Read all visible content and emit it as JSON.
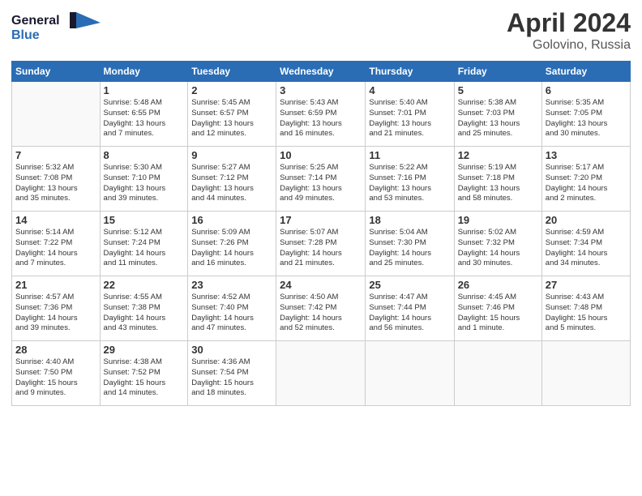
{
  "header": {
    "logo_line1": "General",
    "logo_line2": "Blue",
    "month": "April 2024",
    "location": "Golovino, Russia"
  },
  "weekdays": [
    "Sunday",
    "Monday",
    "Tuesday",
    "Wednesday",
    "Thursday",
    "Friday",
    "Saturday"
  ],
  "weeks": [
    [
      {
        "day": "",
        "info": ""
      },
      {
        "day": "1",
        "info": "Sunrise: 5:48 AM\nSunset: 6:55 PM\nDaylight: 13 hours\nand 7 minutes."
      },
      {
        "day": "2",
        "info": "Sunrise: 5:45 AM\nSunset: 6:57 PM\nDaylight: 13 hours\nand 12 minutes."
      },
      {
        "day": "3",
        "info": "Sunrise: 5:43 AM\nSunset: 6:59 PM\nDaylight: 13 hours\nand 16 minutes."
      },
      {
        "day": "4",
        "info": "Sunrise: 5:40 AM\nSunset: 7:01 PM\nDaylight: 13 hours\nand 21 minutes."
      },
      {
        "day": "5",
        "info": "Sunrise: 5:38 AM\nSunset: 7:03 PM\nDaylight: 13 hours\nand 25 minutes."
      },
      {
        "day": "6",
        "info": "Sunrise: 5:35 AM\nSunset: 7:05 PM\nDaylight: 13 hours\nand 30 minutes."
      }
    ],
    [
      {
        "day": "7",
        "info": "Sunrise: 5:32 AM\nSunset: 7:08 PM\nDaylight: 13 hours\nand 35 minutes."
      },
      {
        "day": "8",
        "info": "Sunrise: 5:30 AM\nSunset: 7:10 PM\nDaylight: 13 hours\nand 39 minutes."
      },
      {
        "day": "9",
        "info": "Sunrise: 5:27 AM\nSunset: 7:12 PM\nDaylight: 13 hours\nand 44 minutes."
      },
      {
        "day": "10",
        "info": "Sunrise: 5:25 AM\nSunset: 7:14 PM\nDaylight: 13 hours\nand 49 minutes."
      },
      {
        "day": "11",
        "info": "Sunrise: 5:22 AM\nSunset: 7:16 PM\nDaylight: 13 hours\nand 53 minutes."
      },
      {
        "day": "12",
        "info": "Sunrise: 5:19 AM\nSunset: 7:18 PM\nDaylight: 13 hours\nand 58 minutes."
      },
      {
        "day": "13",
        "info": "Sunrise: 5:17 AM\nSunset: 7:20 PM\nDaylight: 14 hours\nand 2 minutes."
      }
    ],
    [
      {
        "day": "14",
        "info": "Sunrise: 5:14 AM\nSunset: 7:22 PM\nDaylight: 14 hours\nand 7 minutes."
      },
      {
        "day": "15",
        "info": "Sunrise: 5:12 AM\nSunset: 7:24 PM\nDaylight: 14 hours\nand 11 minutes."
      },
      {
        "day": "16",
        "info": "Sunrise: 5:09 AM\nSunset: 7:26 PM\nDaylight: 14 hours\nand 16 minutes."
      },
      {
        "day": "17",
        "info": "Sunrise: 5:07 AM\nSunset: 7:28 PM\nDaylight: 14 hours\nand 21 minutes."
      },
      {
        "day": "18",
        "info": "Sunrise: 5:04 AM\nSunset: 7:30 PM\nDaylight: 14 hours\nand 25 minutes."
      },
      {
        "day": "19",
        "info": "Sunrise: 5:02 AM\nSunset: 7:32 PM\nDaylight: 14 hours\nand 30 minutes."
      },
      {
        "day": "20",
        "info": "Sunrise: 4:59 AM\nSunset: 7:34 PM\nDaylight: 14 hours\nand 34 minutes."
      }
    ],
    [
      {
        "day": "21",
        "info": "Sunrise: 4:57 AM\nSunset: 7:36 PM\nDaylight: 14 hours\nand 39 minutes."
      },
      {
        "day": "22",
        "info": "Sunrise: 4:55 AM\nSunset: 7:38 PM\nDaylight: 14 hours\nand 43 minutes."
      },
      {
        "day": "23",
        "info": "Sunrise: 4:52 AM\nSunset: 7:40 PM\nDaylight: 14 hours\nand 47 minutes."
      },
      {
        "day": "24",
        "info": "Sunrise: 4:50 AM\nSunset: 7:42 PM\nDaylight: 14 hours\nand 52 minutes."
      },
      {
        "day": "25",
        "info": "Sunrise: 4:47 AM\nSunset: 7:44 PM\nDaylight: 14 hours\nand 56 minutes."
      },
      {
        "day": "26",
        "info": "Sunrise: 4:45 AM\nSunset: 7:46 PM\nDaylight: 15 hours\nand 1 minute."
      },
      {
        "day": "27",
        "info": "Sunrise: 4:43 AM\nSunset: 7:48 PM\nDaylight: 15 hours\nand 5 minutes."
      }
    ],
    [
      {
        "day": "28",
        "info": "Sunrise: 4:40 AM\nSunset: 7:50 PM\nDaylight: 15 hours\nand 9 minutes."
      },
      {
        "day": "29",
        "info": "Sunrise: 4:38 AM\nSunset: 7:52 PM\nDaylight: 15 hours\nand 14 minutes."
      },
      {
        "day": "30",
        "info": "Sunrise: 4:36 AM\nSunset: 7:54 PM\nDaylight: 15 hours\nand 18 minutes."
      },
      {
        "day": "",
        "info": ""
      },
      {
        "day": "",
        "info": ""
      },
      {
        "day": "",
        "info": ""
      },
      {
        "day": "",
        "info": ""
      }
    ]
  ]
}
